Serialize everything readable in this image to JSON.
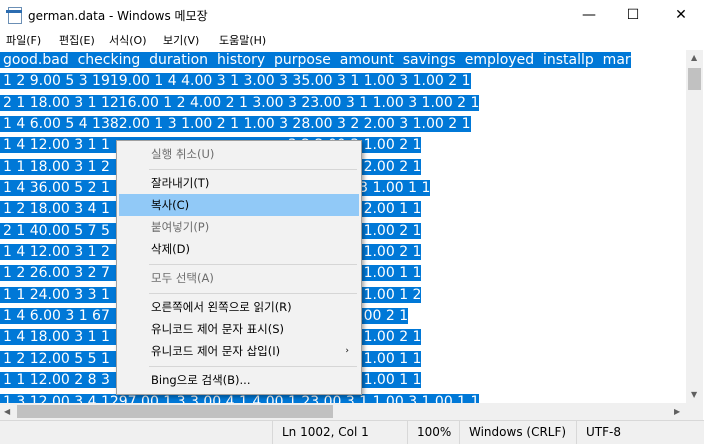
{
  "window": {
    "title": "german.data - Windows 메모장",
    "minimize": "—",
    "maximize": "☐",
    "close": "✕"
  },
  "menu": [
    "파일(F)",
    "편집(E)",
    "서식(O)",
    "보기(V)",
    "도움말(H)"
  ],
  "editor": {
    "lines": [
      "good.bad  checking  duration  history  purpose  amount  savings  employed  installp  mar",
      "1 2 9.00 5 3 1919.00 1 4 4.00 3 1 3.00 3 35.00 3 1 1.00 3 1.00 2 1",
      "2 1 18.00 3 1 1216.00 1 2 4.00 2 1 3.00 3 23.00 3 1 1.00 3 1.00 2 1",
      "1 4 6.00 5 4 1382.00 1 3 1.00 2 1 1.00 3 28.00 3 2 2.00 3 1.00 2 1",
      "1 4 12.00 3 1 1                                        3 2 2.00 3 1.00 2 1",
      "1 1 18.00 3 1 2                                        3 2 1.00 4 2.00 2 1",
      "1 4 36.00 5 2 1                                       0 3 3 2.00 3 1.00 1 1",
      "1 2 18.00 3 4 1                                        3 2 1.00 2 2.00 1 1",
      "2 1 40.00 5 7 5                                        1 2 1.00 3 1.00 2 1",
      "1 4 12.00 3 1 2                                        3 3 1.00 4 1.00 2 1",
      "1 2 26.00 3 2 7                                        3 2 2.00 3 1.00 1 1",
      "1 1 24.00 3 3 1                                        3 2 1.00 2 1.00 1 2",
      "1 4 6.00 3 1 67                                        2 1.00 1 1.00 2 1",
      "1 4 18.00 3 1 1                                        3 2 1.00 4 1.00 2 1",
      "1 2 12.00 5 5 1                                        3 3 1.00 3 1.00 1 1",
      "1 1 12.00 2 8 3                                        1 2 1.00 2 1.00 1 1",
      "1 3 12.00 3 4 1297.00 1 3 3.00 4 1 4.00 1 23.00 3 1 1.00 3 1.00 1 1"
    ]
  },
  "status": {
    "position": "Ln 1002, Col 1",
    "zoom": "100%",
    "line_ending": "Windows (CRLF)",
    "encoding": "UTF-8"
  },
  "context_menu": {
    "undo": "실행 취소(U)",
    "cut": "잘라내기(T)",
    "copy": "복사(C)",
    "paste": "붙여넣기(P)",
    "delete": "삭제(D)",
    "select_all": "모두 선택(A)",
    "rtl": "오른쪽에서 왼쪽으로 읽기(R)",
    "show_unicode": "유니코드 제어 문자 표시(S)",
    "insert_unicode": "유니코드 제어 문자 삽입(I)",
    "bing_search": "Bing으로 검색(B)..."
  }
}
